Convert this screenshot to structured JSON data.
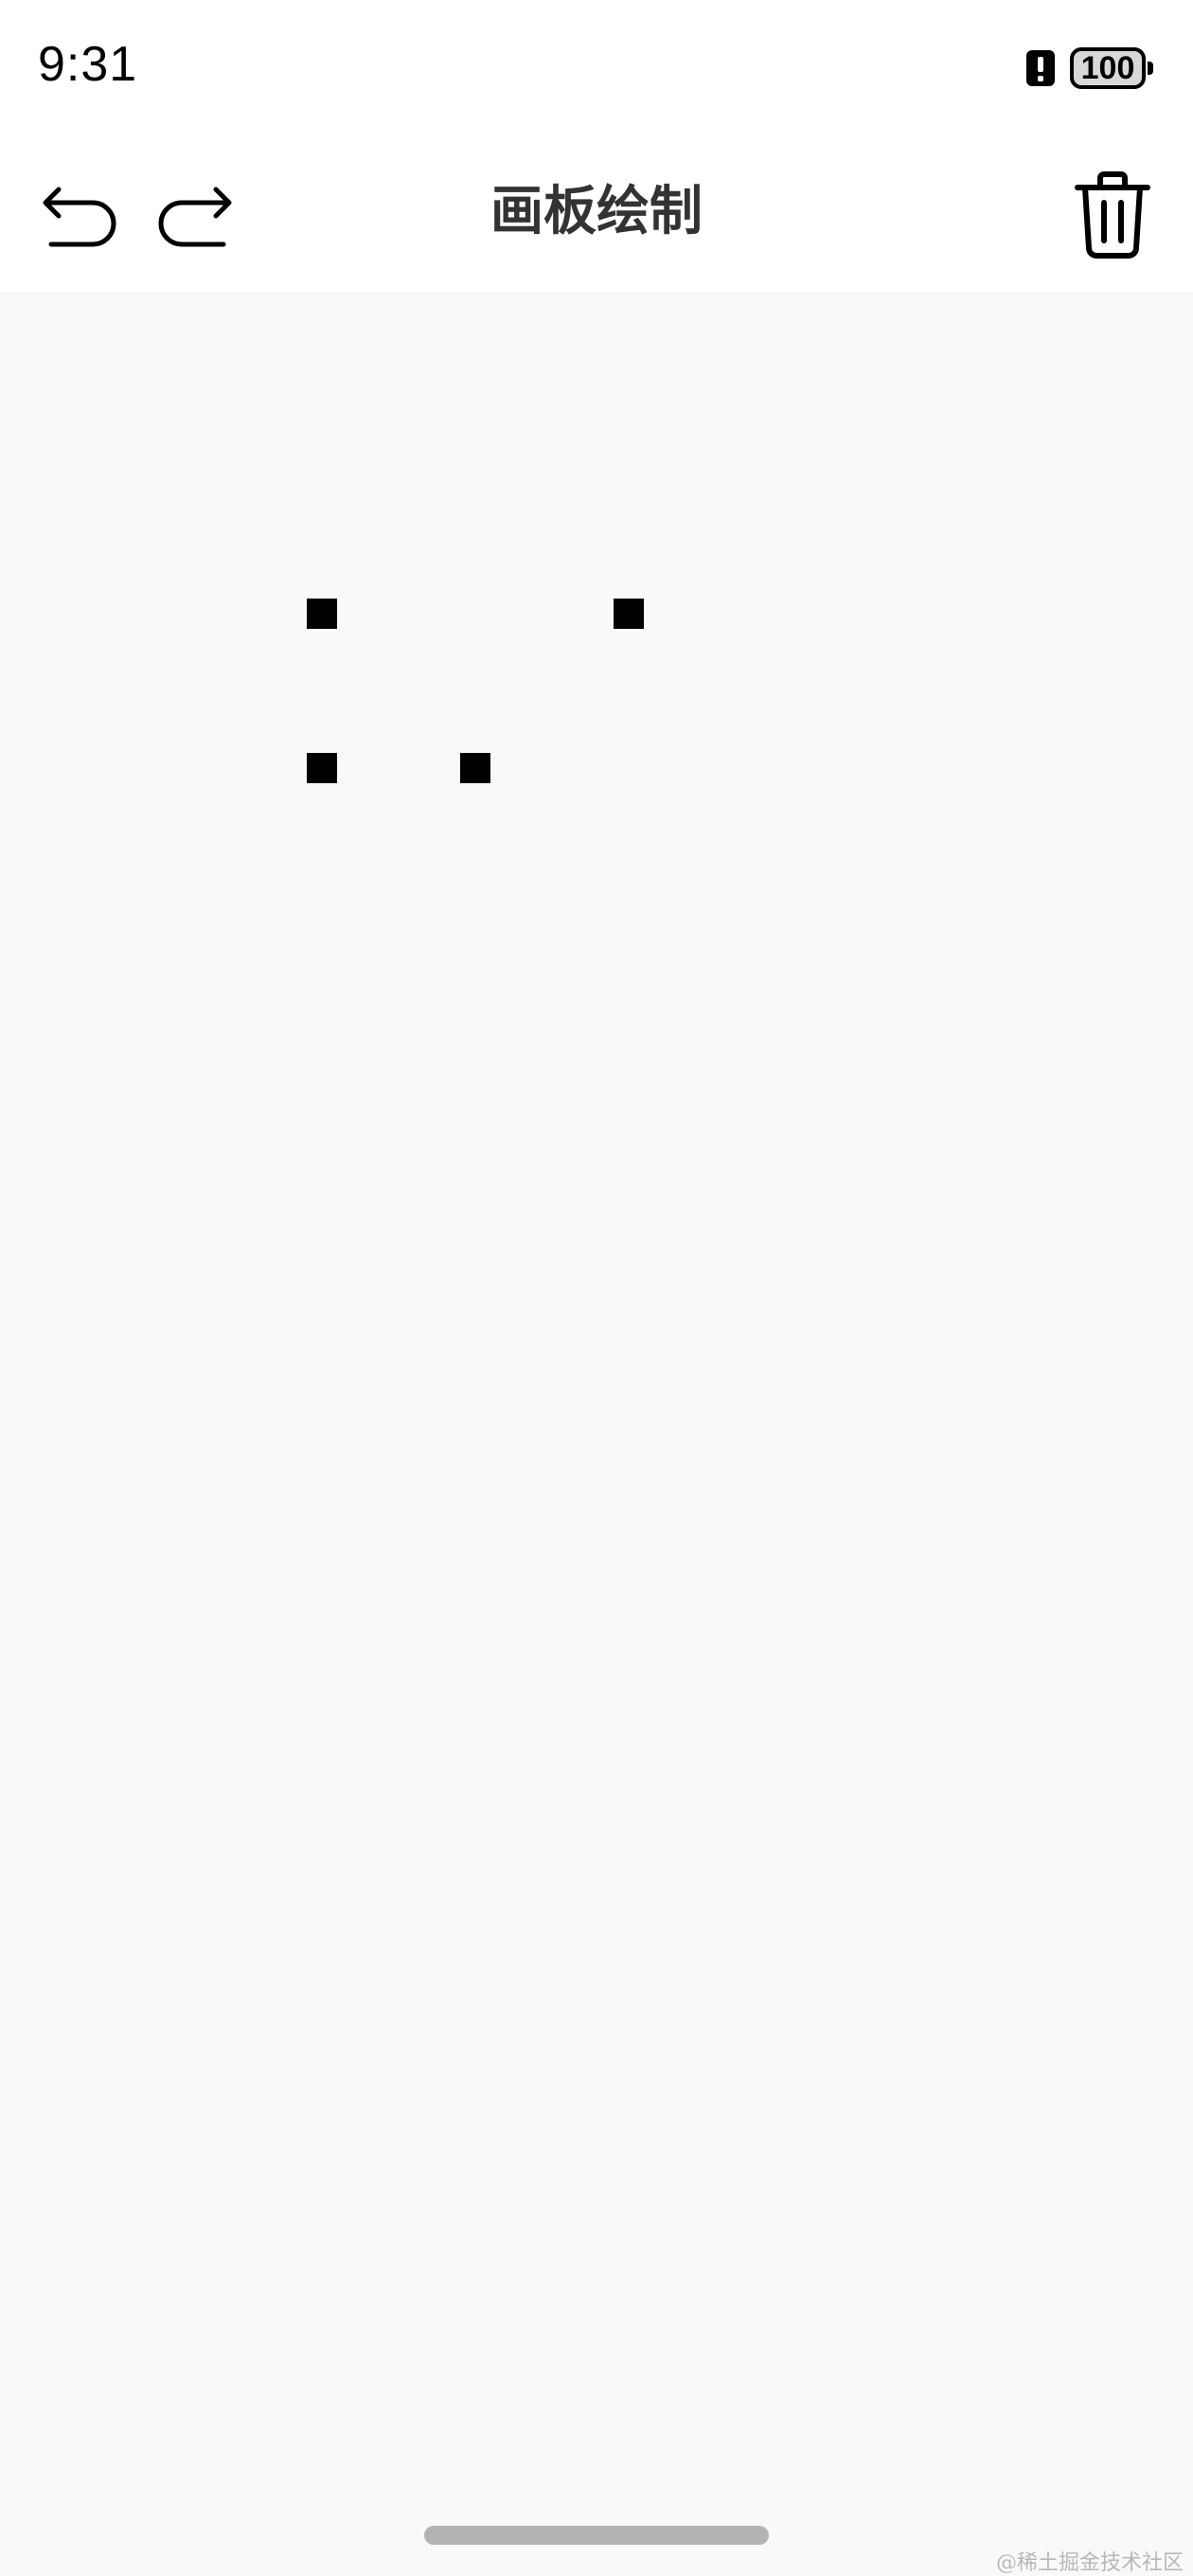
{
  "status_bar": {
    "time": "9:31",
    "alert_icon": "alert-icon",
    "battery_level": "100"
  },
  "toolbar": {
    "title": "画板绘制",
    "undo_icon": "undo-icon",
    "redo_icon": "redo-icon",
    "clear_icon": "trash-icon"
  },
  "canvas": {
    "background_color": "#f9f9f9",
    "stroke_color": "#000000"
  },
  "watermark": "@稀土掘金技术社区",
  "colors": {
    "title": "#333333",
    "icon": "#000000",
    "home_indicator": "#b3b3b3"
  }
}
